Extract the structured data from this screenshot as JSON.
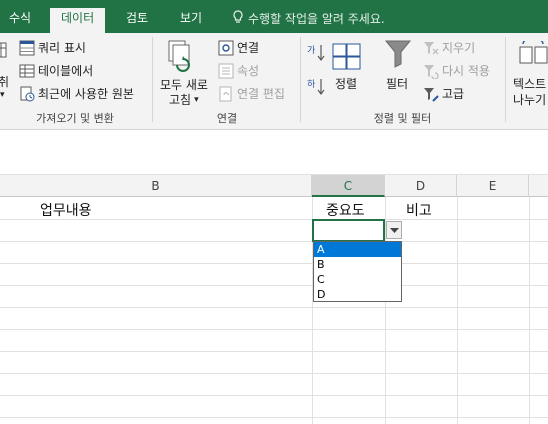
{
  "tabs": {
    "formulas": "수식",
    "data": "데이터",
    "review": "검토",
    "view": "보기"
  },
  "tell_me": "수행할 작업을 알려 주세요.",
  "ribbon": {
    "get_transform": {
      "partial_label": "취",
      "show_queries": "쿼리 표시",
      "from_table": "테이블에서",
      "recent_sources": "최근에 사용한 원본",
      "group_label": "가져오기 및 변환"
    },
    "connections": {
      "refresh_all_line1": "모두 새로",
      "refresh_all_line2": "고침",
      "connections": "연결",
      "properties": "속성",
      "edit_links": "연결 편집",
      "group_label": "연결"
    },
    "sort_filter": {
      "sort": "정렬",
      "filter": "필터",
      "clear": "지우기",
      "reapply": "다시 적용",
      "advanced": "고급",
      "group_label": "정렬 및 필터"
    },
    "text_to_columns": {
      "line1": "텍스트",
      "line2": "나누기"
    }
  },
  "columns": [
    "B",
    "C",
    "D",
    "E"
  ],
  "cells": {
    "b_header": "업무내용",
    "c_header": "중요도",
    "d_header": "비고"
  },
  "dropdown": {
    "options": [
      "A",
      "B",
      "C",
      "D"
    ],
    "highlighted": "A"
  },
  "colors": {
    "accent": "#217346",
    "highlight": "#0078d7"
  }
}
